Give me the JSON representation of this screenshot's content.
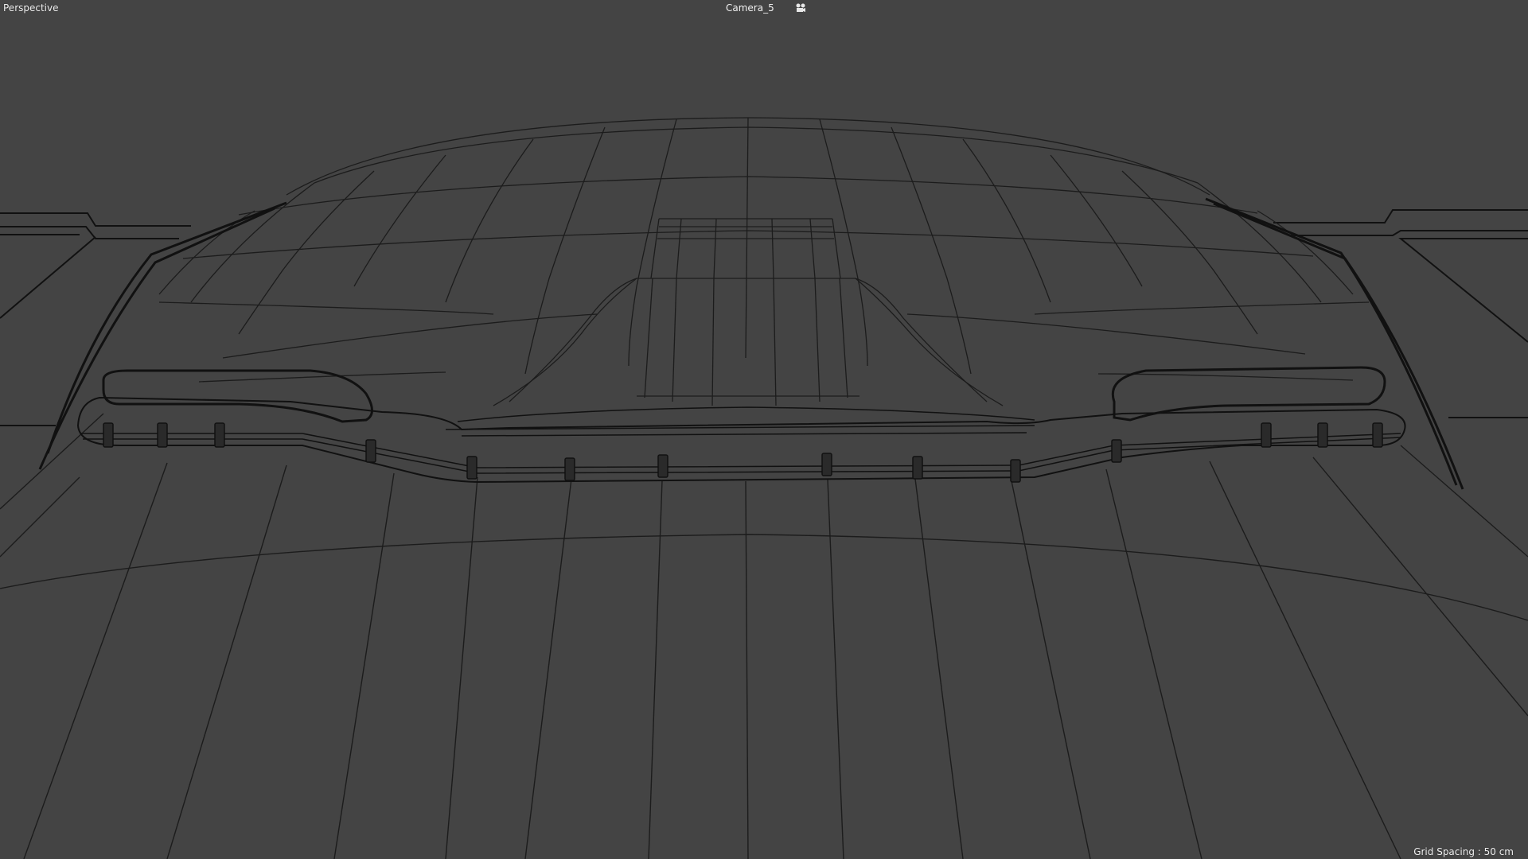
{
  "viewport": {
    "view_mode": "Perspective",
    "camera_name": "Camera_5",
    "camera_icon": "camera-icon",
    "grid_spacing": "Grid Spacing : 50 cm",
    "colors": {
      "background": "#444444",
      "wire_thin": "#1c1c1c",
      "wire_thick": "#111111",
      "text": "#f0f0f0"
    }
  }
}
